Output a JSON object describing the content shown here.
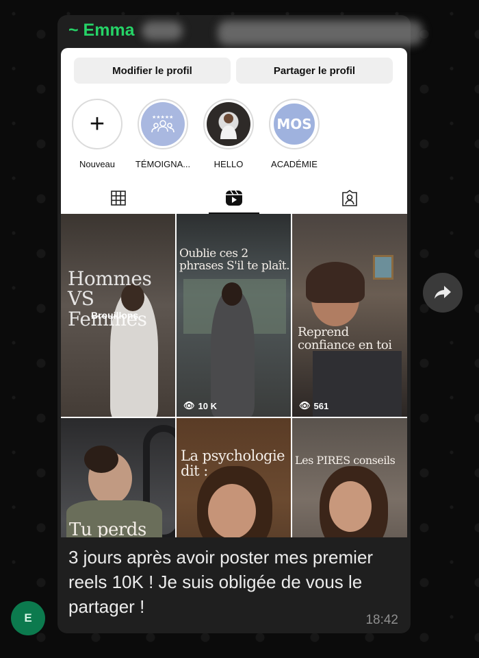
{
  "sender": {
    "name": "~ Emma"
  },
  "profile": {
    "edit_button": "Modifier le profil",
    "share_button": "Partager le profil"
  },
  "highlights": [
    {
      "label": "Nouveau",
      "icon": "plus-icon"
    },
    {
      "label": "TÉMOIGNA...",
      "icon": "group-stars-icon"
    },
    {
      "label": "HELLO",
      "icon": "photo"
    },
    {
      "label": "ACADÉMIE",
      "icon": "text",
      "text": "MOS"
    }
  ],
  "tabs": [
    {
      "name": "grid-icon",
      "active": false
    },
    {
      "name": "reels-icon",
      "active": true
    },
    {
      "name": "tagged-icon",
      "active": false
    }
  ],
  "reels": [
    {
      "title": "Hommes VS Femmes",
      "badge": "Brouillons",
      "views": ""
    },
    {
      "title": "Oublie ces 2 phrases S'il te plaît.",
      "views": "10 K"
    },
    {
      "title": "Reprend confiance en toi",
      "views": "561"
    },
    {
      "title": "Tu perds",
      "views": ""
    },
    {
      "title": "La psychologie dit :",
      "views": ""
    },
    {
      "title": "Les PIRES conseils",
      "views": ""
    }
  ],
  "message": {
    "text": "3 jours après avoir poster mes premier reels 10K ! Je suis obligée de vous le partager !",
    "time": "18:42"
  },
  "avatar_letter": "E",
  "colors": {
    "sender": "#26d367",
    "bubble": "#1f1f1f",
    "avatar": "#0c7a4e"
  }
}
